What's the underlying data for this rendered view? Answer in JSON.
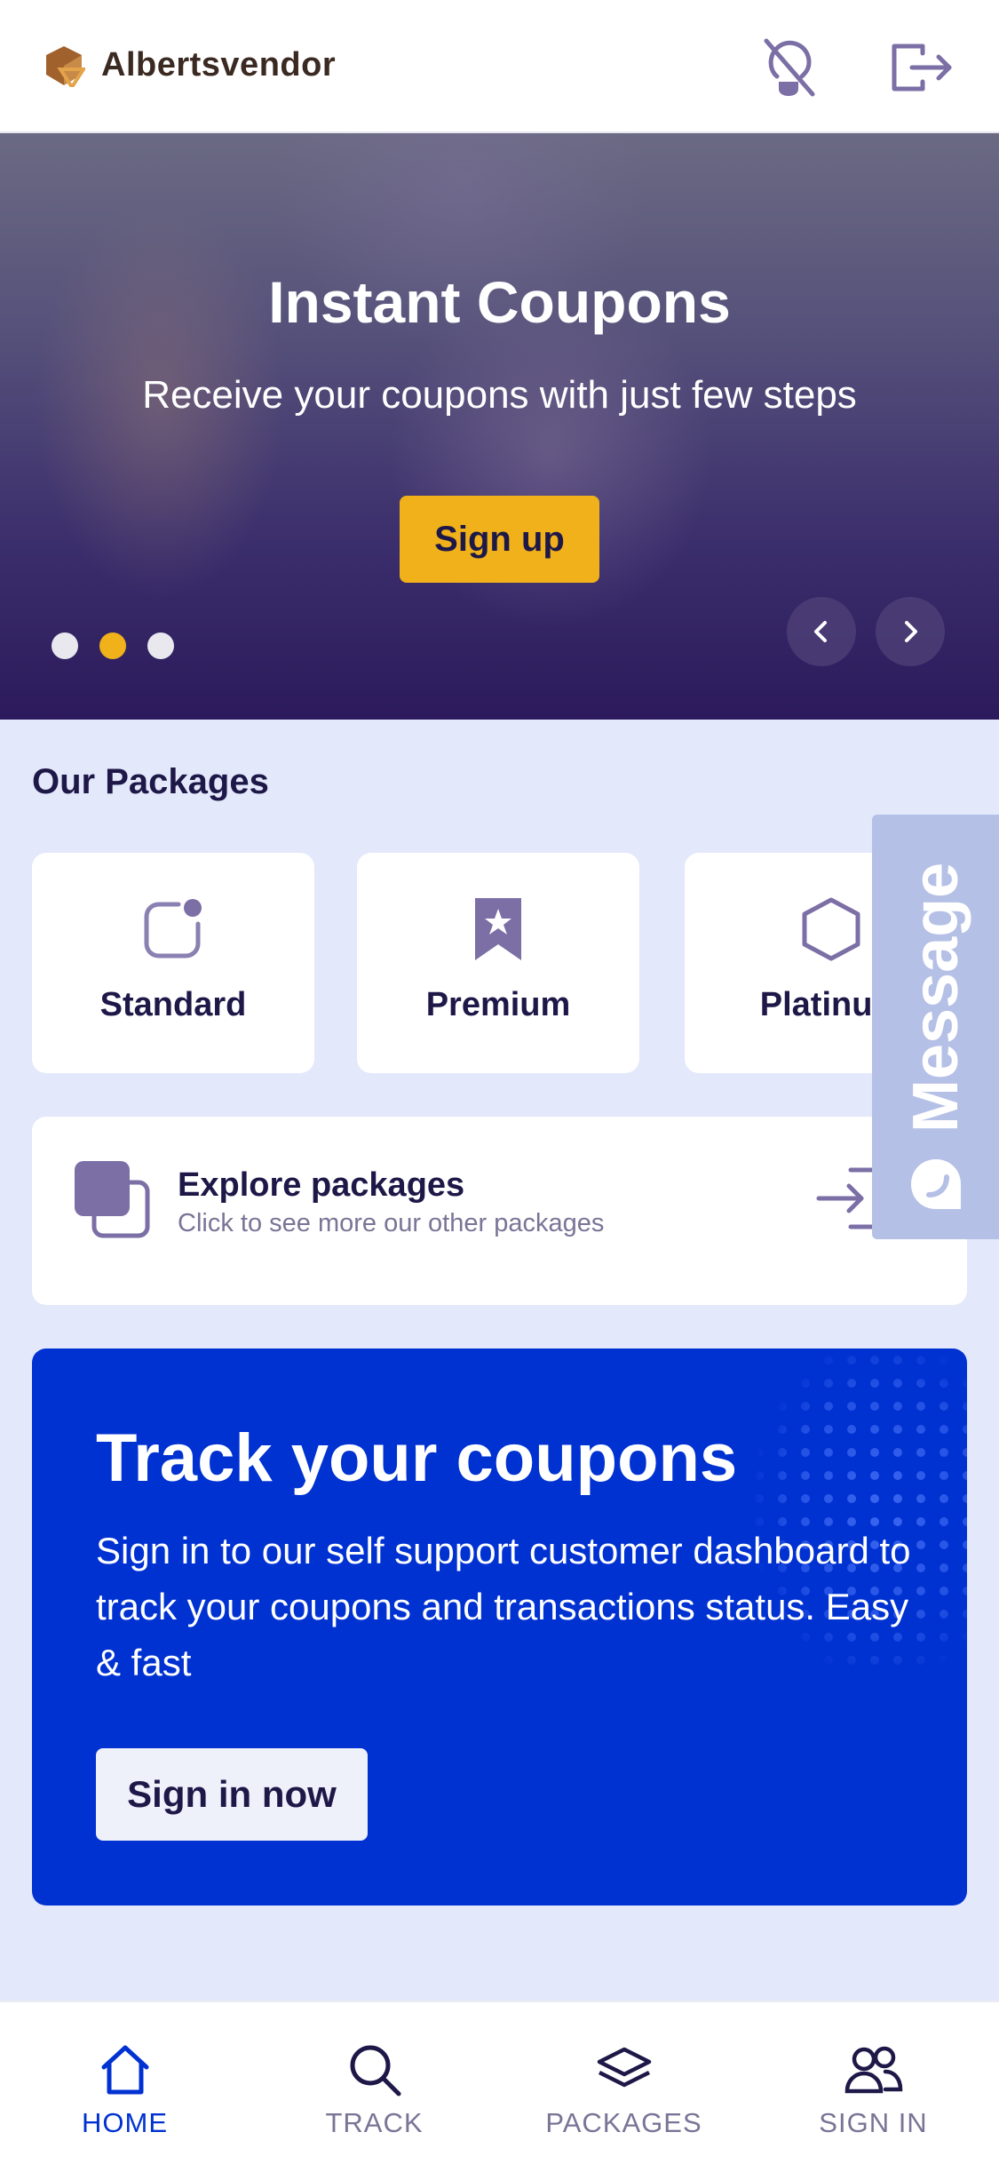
{
  "header": {
    "brand": "Albertsvendor",
    "icons": [
      "logo-icon",
      "lightbulb-off-icon",
      "logout-icon"
    ]
  },
  "hero": {
    "title": "Instant Coupons",
    "subtitle": "Receive your coupons with just few steps",
    "button_label": "Sign up",
    "slides_total": 3,
    "active_slide": 2
  },
  "packages": {
    "title": "Our Packages",
    "items": [
      {
        "label": "Standard",
        "icon": "notification-square-icon"
      },
      {
        "label": "Premium",
        "icon": "bookmark-star-icon"
      },
      {
        "label": "Platinum",
        "icon": "hexagon-icon"
      }
    ],
    "explore": {
      "title": "Explore packages",
      "subtitle": "Click to see more our other packages"
    }
  },
  "message_tab": {
    "label": "Message"
  },
  "track": {
    "title": "Track your coupons",
    "body": "Sign in to our self support customer dashboard to track your coupons and transactions status. Easy & fast",
    "button_label": "Sign in now"
  },
  "bottom_nav": {
    "items": [
      {
        "label": "HOME",
        "icon": "home-icon",
        "active": true
      },
      {
        "label": "TRACK",
        "icon": "search-icon",
        "active": false
      },
      {
        "label": "PACKAGES",
        "icon": "layers-icon",
        "active": false
      },
      {
        "label": "SIGN IN",
        "icon": "users-icon",
        "active": false
      }
    ]
  },
  "colors": {
    "primary": "#0032d2",
    "accent": "#f0b11a",
    "text_dark": "#1e1848",
    "muted": "#7a7496",
    "background": "#e3e8fb"
  }
}
